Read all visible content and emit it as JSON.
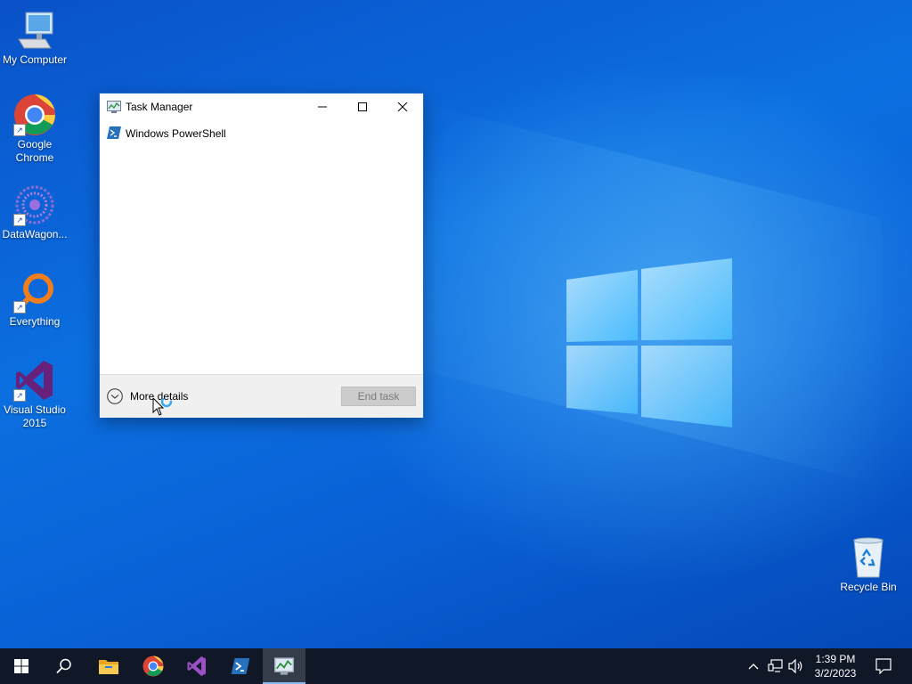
{
  "desktop": {
    "icons": [
      {
        "label": "My Computer"
      },
      {
        "label": "Google Chrome"
      },
      {
        "label": "DataWagon..."
      },
      {
        "label": "Everything"
      },
      {
        "label": "Visual Studio 2015"
      },
      {
        "label": "Recycle Bin"
      }
    ],
    "shortcut_glyph": "↗"
  },
  "task_manager": {
    "title": "Task Manager",
    "processes": [
      {
        "name": "Windows PowerShell",
        "icon": "powershell-icon"
      }
    ],
    "more_details_label": "More details",
    "end_task_label": "End task"
  },
  "taskbar": {
    "pinned": [
      {
        "name": "start-button",
        "icon": "windows-logo-icon"
      },
      {
        "name": "search-button",
        "icon": "search-icon"
      },
      {
        "name": "file-explorer-button",
        "icon": "folder-icon"
      },
      {
        "name": "chrome-button",
        "icon": "chrome-icon"
      },
      {
        "name": "visual-studio-button",
        "icon": "visual-studio-icon"
      },
      {
        "name": "powershell-button",
        "icon": "powershell-icon"
      },
      {
        "name": "task-manager-button",
        "icon": "task-manager-icon",
        "active": true
      }
    ],
    "clock_time": "1:39 PM",
    "clock_date": "3/2/2023"
  },
  "colors": {
    "desktop_blue": "#0a63d8",
    "taskbar": "#101828",
    "vs_purple": "#68217a",
    "powershell_blue": "#2671be"
  }
}
